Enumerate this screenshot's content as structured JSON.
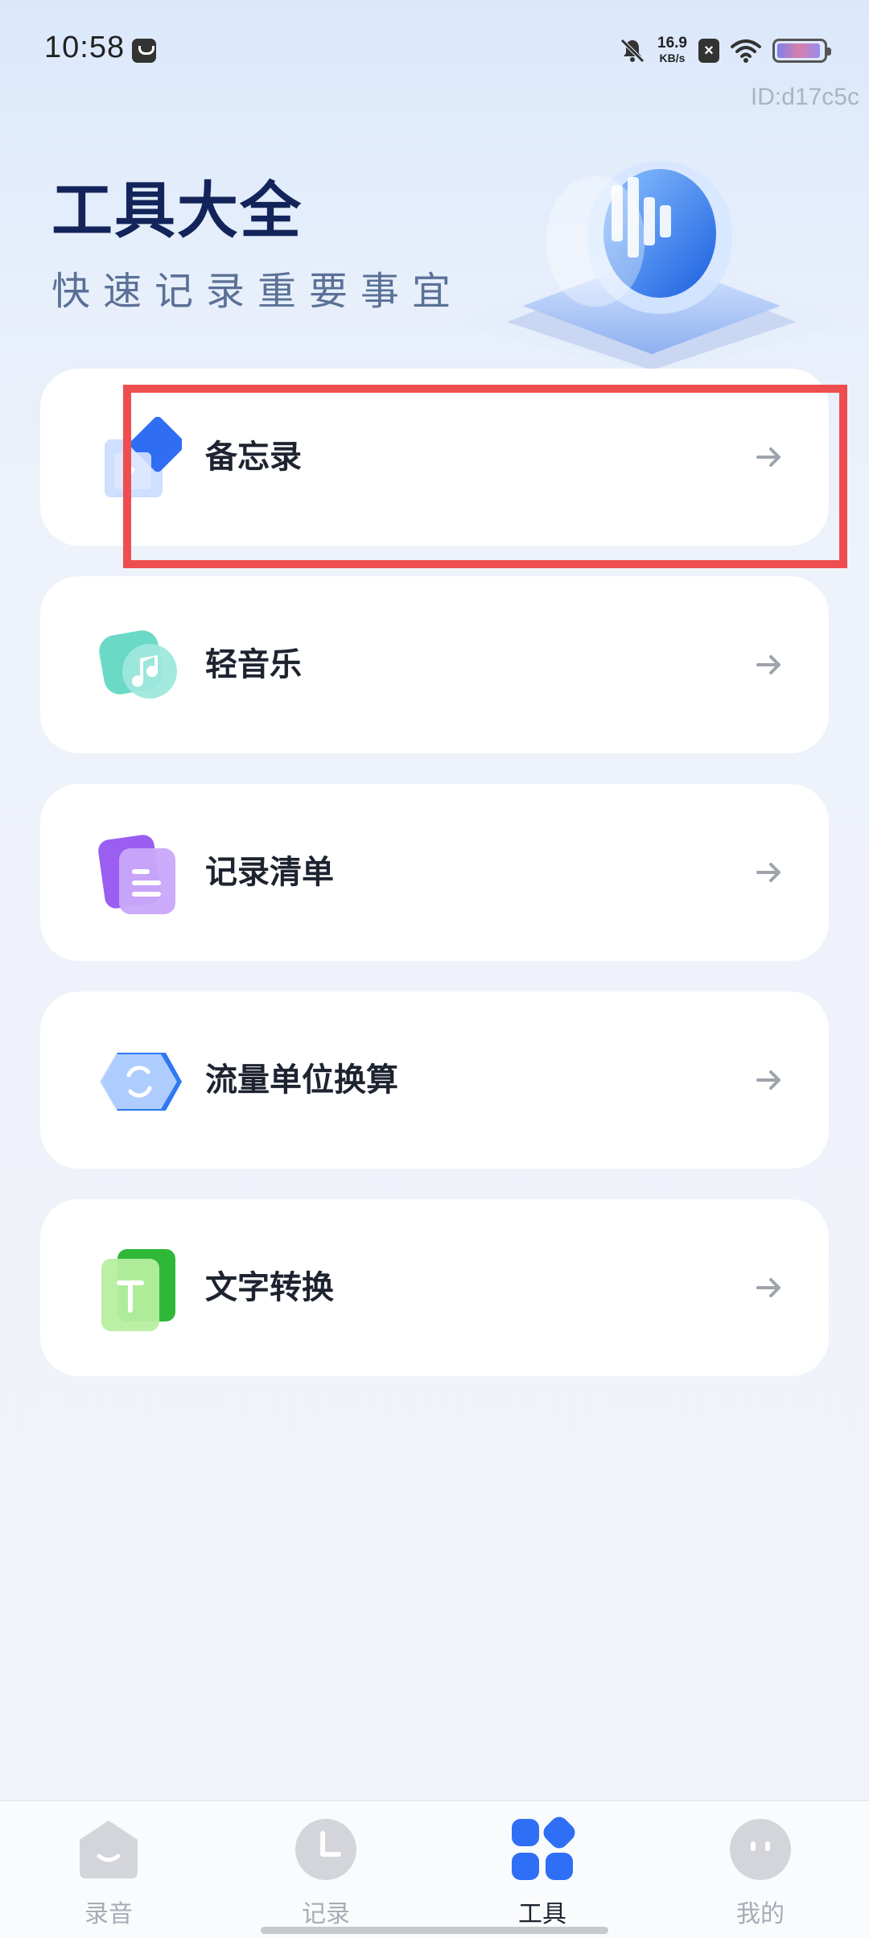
{
  "status_bar": {
    "time": "10:58",
    "net_speed_value": "16.9",
    "net_speed_unit": "KB/s",
    "battery_level": 0.95,
    "device_id": "ID:d17c5c"
  },
  "hero": {
    "title": "工具大全",
    "subtitle": "快速记录重要事宜"
  },
  "tools": [
    {
      "label": "备忘录",
      "icon": "memo-icon",
      "color": "#3b7cf5"
    },
    {
      "label": "轻音乐",
      "icon": "music-note-icon",
      "color": "#3ec9b8"
    },
    {
      "label": "记录清单",
      "icon": "checklist-icon",
      "color": "#9a62ef"
    },
    {
      "label": "流量单位换算",
      "icon": "convert-icon",
      "color": "#3b84f5"
    },
    {
      "label": "文字转换",
      "icon": "text-convert-icon",
      "color": "#44c24a"
    }
  ],
  "bottom_nav": {
    "items": [
      {
        "label": "录音",
        "icon": "record-icon"
      },
      {
        "label": "记录",
        "icon": "clock-icon"
      },
      {
        "label": "工具",
        "icon": "grid-icon"
      },
      {
        "label": "我的",
        "icon": "profile-icon"
      }
    ],
    "active_index": 2,
    "active_color": "#2e6ff5"
  }
}
